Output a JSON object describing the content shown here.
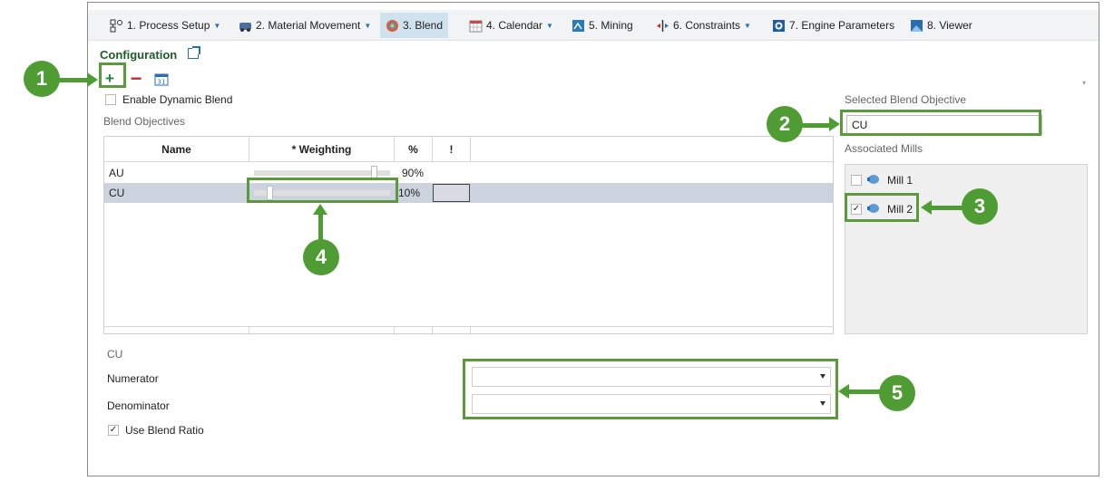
{
  "tabs": [
    {
      "label": "1. Process Setup",
      "icon": "process-setup-icon",
      "caret": true
    },
    {
      "label": "2. Material Movement",
      "icon": "material-movement-icon",
      "caret": true
    },
    {
      "label": "3. Blend",
      "icon": "blend-icon",
      "caret": false,
      "active": true
    },
    {
      "label": "4. Calendar",
      "icon": "calendar-icon",
      "caret": true
    },
    {
      "label": "5. Mining",
      "icon": "mining-icon",
      "caret": false
    },
    {
      "label": "6. Constraints",
      "icon": "constraints-icon",
      "caret": true
    },
    {
      "label": "7. Engine Parameters",
      "icon": "engine-parameters-icon",
      "caret": false
    },
    {
      "label": "8. Viewer",
      "icon": "viewer-icon",
      "caret": false
    }
  ],
  "config": {
    "title": "Configuration",
    "enable_dynamic_blend": "Enable Dynamic Blend",
    "blend_objectives_label": "Blend Objectives"
  },
  "grid": {
    "headers": [
      "Name",
      "* Weighting",
      "%",
      "!"
    ],
    "rows": [
      {
        "name": "AU",
        "weighting": 0.9,
        "percent": "90%",
        "selected": false
      },
      {
        "name": "CU",
        "weighting": 0.1,
        "percent": "10%",
        "selected": true
      }
    ]
  },
  "right_panel": {
    "selected_label": "Selected Blend Objective",
    "selected_value": "CU",
    "associated_label": "Associated Mills",
    "mills": [
      {
        "label": "Mill 1",
        "checked": false
      },
      {
        "label": "Mill 2",
        "checked": true
      }
    ]
  },
  "details": {
    "heading": "CU",
    "numerator_label": "Numerator",
    "numerator_value": "",
    "denominator_label": "Denominator",
    "denominator_value": "",
    "use_blend_ratio": "Use Blend Ratio",
    "use_blend_ratio_checked": true
  },
  "callouts": [
    "1",
    "2",
    "3",
    "4",
    "5"
  ],
  "colors": {
    "callout": "#4f9c34",
    "selection": "#cdd3de",
    "accent": "#2a6db0"
  }
}
